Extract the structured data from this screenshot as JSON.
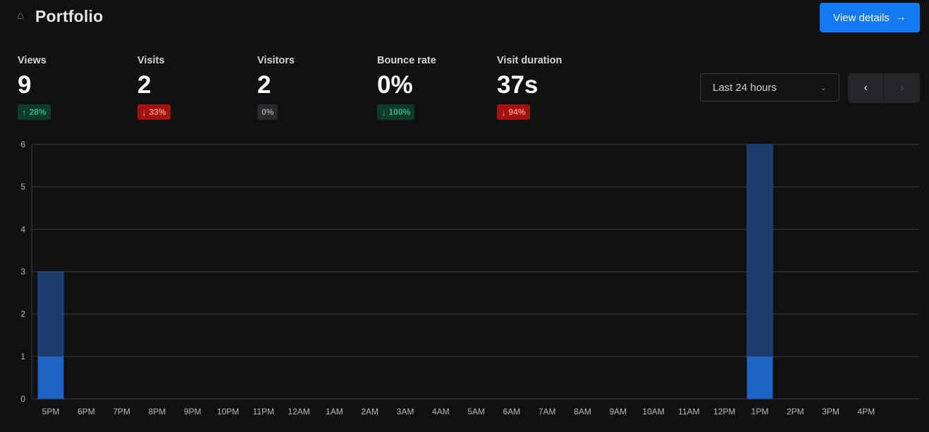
{
  "header": {
    "site_title": "Portfolio",
    "site_icon": "home-icon",
    "details_button_label": "View details"
  },
  "metrics": [
    {
      "label": "Views",
      "value": "9",
      "change": "28%",
      "direction": "up"
    },
    {
      "label": "Visits",
      "value": "2",
      "change": "33%",
      "direction": "down"
    },
    {
      "label": "Visitors",
      "value": "2",
      "change": "0%",
      "direction": "flat"
    },
    {
      "label": "Bounce rate",
      "value": "0%",
      "change": "100%",
      "direction": "down-good"
    },
    {
      "label": "Visit duration",
      "value": "37s",
      "change": "94%",
      "direction": "down"
    }
  ],
  "filters": {
    "date_range": "Last 24 hours"
  },
  "colors": {
    "accent": "#147af3",
    "views_bar": "#1c3d6b",
    "visitors_bar": "#1f63c4",
    "up": "#2fb37b",
    "down": "#ff8c83"
  },
  "chart_data": {
    "type": "bar",
    "categories": [
      "5PM",
      "6PM",
      "7PM",
      "8PM",
      "9PM",
      "10PM",
      "11PM",
      "12AM",
      "1AM",
      "2AM",
      "3AM",
      "4AM",
      "5AM",
      "6AM",
      "7AM",
      "8AM",
      "9AM",
      "10AM",
      "11AM",
      "12PM",
      "1PM",
      "2PM",
      "3PM",
      "4PM"
    ],
    "series": [
      {
        "name": "",
        "values": [
          3,
          0,
          0,
          0,
          0,
          0,
          0,
          0,
          0,
          0,
          0,
          0,
          0,
          0,
          0,
          0,
          0,
          0,
          0,
          0,
          6,
          0,
          0,
          0
        ]
      },
      {
        "name": "",
        "values": [
          1,
          0,
          0,
          0,
          0,
          0,
          0,
          0,
          0,
          0,
          0,
          0,
          0,
          0,
          0,
          0,
          0,
          0,
          0,
          0,
          1,
          0,
          0,
          0
        ]
      }
    ],
    "yticks": [
      0,
      1,
      2,
      3,
      4,
      5,
      6
    ],
    "ylim": [
      0,
      6
    ],
    "grid": true
  }
}
